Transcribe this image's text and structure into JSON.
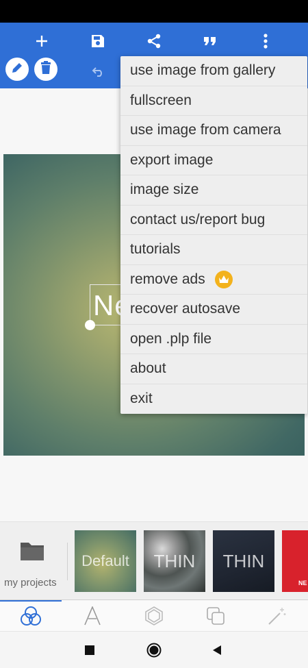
{
  "toolbar": {
    "icons": [
      "add-icon",
      "save-icon",
      "share-icon",
      "quote-icon",
      "more-vert-icon"
    ],
    "secondary_icons": [
      "pencil-icon",
      "trash-icon",
      "undo-icon"
    ]
  },
  "canvas": {
    "text_preview": "Ne"
  },
  "menu": {
    "items": [
      {
        "label": "use image from gallery"
      },
      {
        "label": "fullscreen"
      },
      {
        "label": "use image from camera"
      },
      {
        "label": "export image"
      },
      {
        "label": "image size"
      },
      {
        "label": "contact us/report bug"
      },
      {
        "label": "tutorials"
      },
      {
        "label": "remove ads",
        "icon": "crown-icon"
      },
      {
        "label": "recover autosave"
      },
      {
        "label": "open .plp file"
      },
      {
        "label": "about"
      },
      {
        "label": "exit"
      }
    ]
  },
  "strip": {
    "projects_label": "my projects",
    "thumbs": [
      {
        "label": "Default"
      },
      {
        "label": "THIN"
      },
      {
        "label": "THIN"
      },
      {
        "label": "NE"
      }
    ]
  },
  "bottom_tabs": [
    "layers-icon",
    "text-icon",
    "shape-icon",
    "copy-icon",
    "magic-wand-icon"
  ],
  "navbar": [
    "recents-icon",
    "home-icon",
    "back-icon"
  ],
  "colors": {
    "toolbar": "#2f6fd6",
    "menu_bg": "#eeeeee",
    "accent": "#2f6fd6",
    "crown": "#f3b21c"
  }
}
